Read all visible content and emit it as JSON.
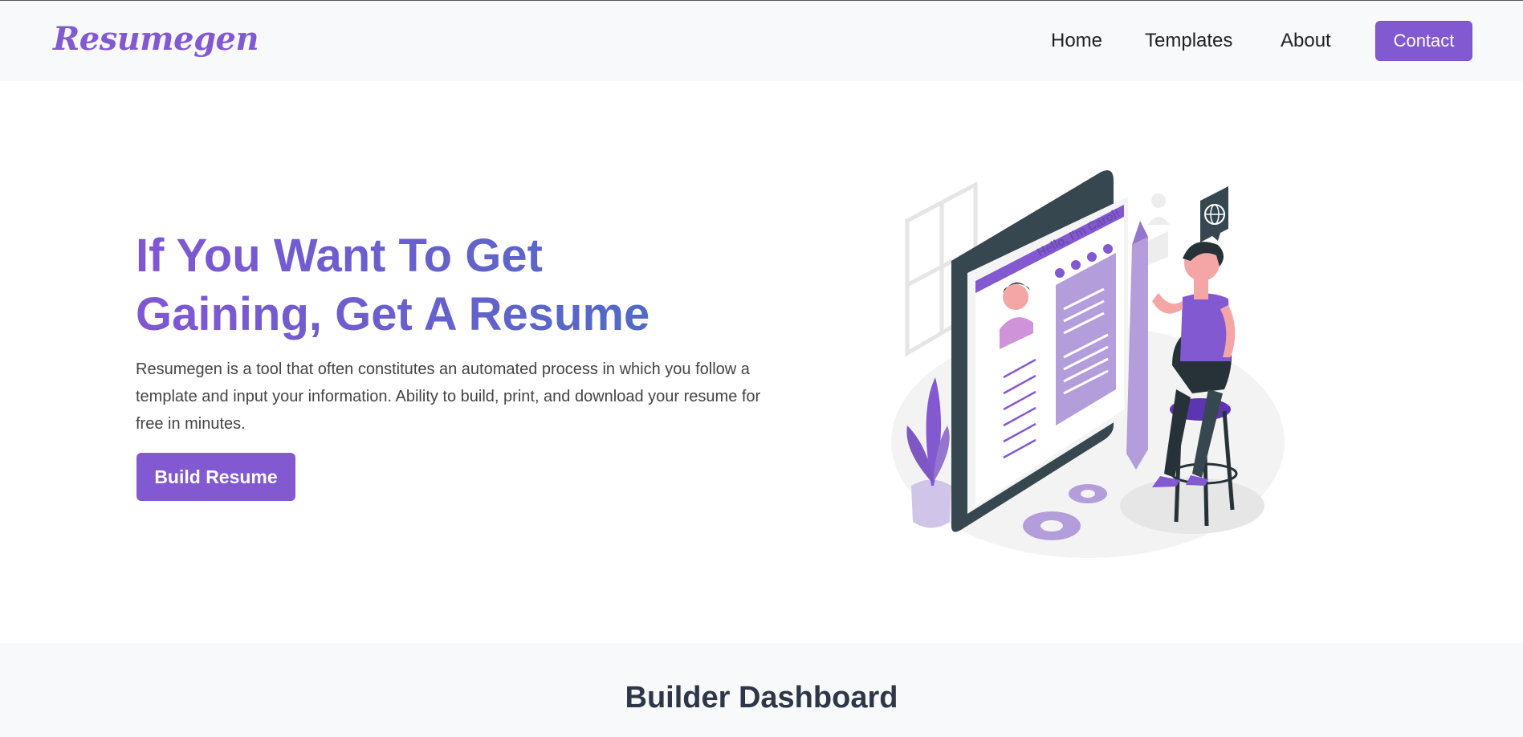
{
  "navbar": {
    "logo": "Resumegen",
    "links": [
      "Home",
      "Templates",
      "About"
    ],
    "contact_label": "Contact"
  },
  "hero": {
    "title_line1": "If You Want To Get",
    "title_line2": "Gaining, Get A Resume",
    "description": "Resumegen is a tool that often constitutes an automated process in which you follow a template and input your information. Ability to build, print, and download your resume for free in minutes.",
    "cta_label": "Build Resume",
    "illustration_greeting": "Hello, I'm Carol!"
  },
  "dashboard": {
    "title": "Builder Dashboard"
  },
  "colors": {
    "accent": "#8359d2",
    "gradient_end": "#4a6ec2",
    "nav_bg": "#f8f9fa"
  }
}
